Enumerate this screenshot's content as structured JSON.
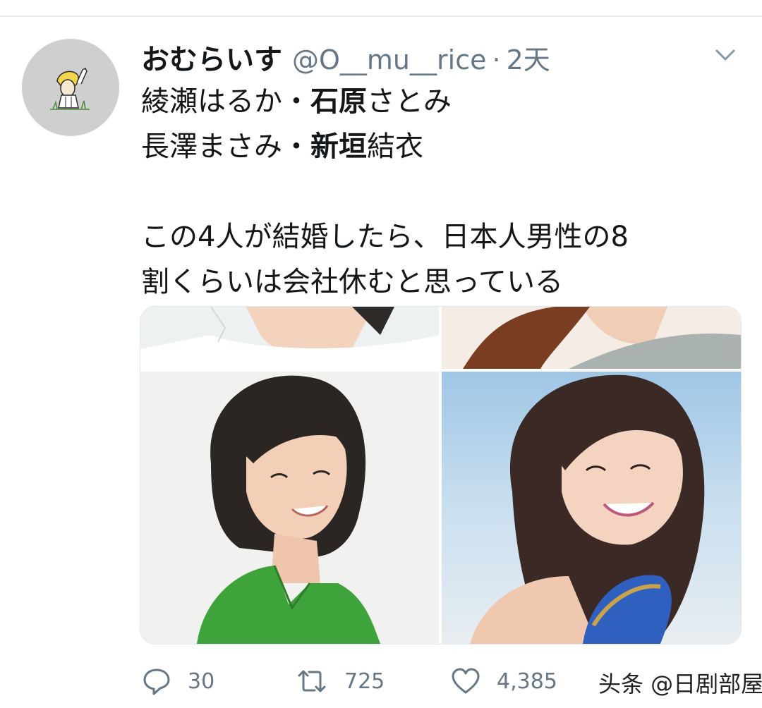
{
  "tweet": {
    "display_name": "おむらいす",
    "handle": "@O__mu__rice",
    "separator": "·",
    "time": "2天",
    "text_lines": [
      [
        {
          "text": "綾瀬はるか・",
          "bold": false
        },
        {
          "text": "石原",
          "bold": true
        },
        {
          "text": "さとみ",
          "bold": false
        }
      ],
      [
        {
          "text": "長澤まさみ・",
          "bold": false
        },
        {
          "text": "新垣",
          "bold": true
        },
        {
          "text": "結衣",
          "bold": false
        }
      ],
      [],
      [
        {
          "text": "この4人が結婚したら、日本人男性の8",
          "bold": false
        }
      ],
      [
        {
          "text": "割くらいは会社休むと思っている",
          "bold": false
        }
      ]
    ]
  },
  "actions": {
    "reply_count": "30",
    "retweet_count": "725",
    "like_count": "4,385"
  },
  "icons": {
    "reply": "reply-icon",
    "retweet": "retweet-icon",
    "like": "heart-icon",
    "menu": "chevron-down-icon"
  },
  "colors": {
    "text": "#14171a",
    "secondary": "#657786",
    "divider": "#e6ecf0"
  },
  "watermark": {
    "text": "头条 @日剧部屋"
  }
}
